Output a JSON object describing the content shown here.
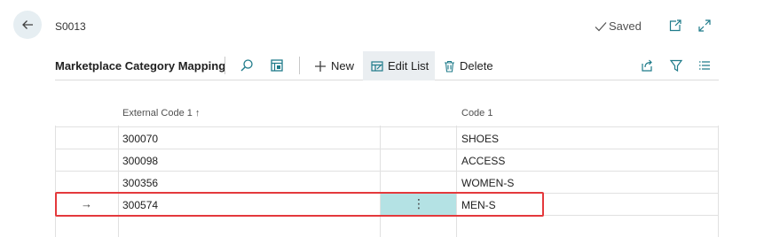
{
  "header": {
    "doc_id": "S0013",
    "saved_label": "Saved"
  },
  "action_bar": {
    "title": "Marketplace Category Mapping",
    "new_label": "New",
    "edit_list_label": "Edit List",
    "delete_label": "Delete"
  },
  "table": {
    "columns": [
      "External Code 1 ↑",
      "Code 1"
    ],
    "rows": [
      {
        "external_code": "300070",
        "code": "SHOES"
      },
      {
        "external_code": "300098",
        "code": "ACCESS"
      },
      {
        "external_code": "300356",
        "code": "WOMEN-S"
      },
      {
        "external_code": "300574",
        "code": "MEN-S",
        "selected": true
      }
    ],
    "row_arrow": "→",
    "row_menu": "⋮"
  },
  "colors": {
    "accent": "#1f7b8a",
    "selected_cell": "#b4e2e4",
    "highlight_border": "#e4393c"
  }
}
